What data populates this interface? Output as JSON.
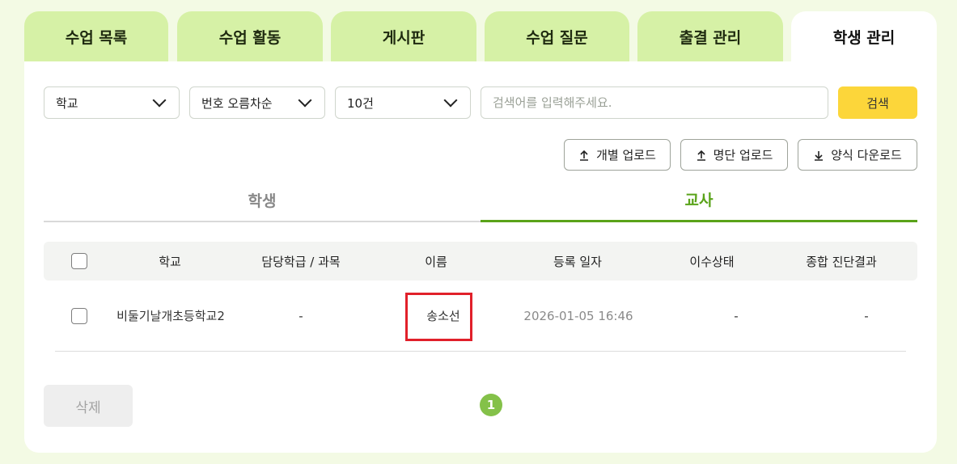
{
  "tabs": [
    {
      "label": "수업 목록"
    },
    {
      "label": "수업 활동"
    },
    {
      "label": "게시판"
    },
    {
      "label": "수업 질문"
    },
    {
      "label": "출결 관리"
    },
    {
      "label": "학생 관리",
      "active": true
    }
  ],
  "filters": {
    "school": "학교",
    "sort": "번호 오름차순",
    "page_size": "10건",
    "search_placeholder": "검색어를 입력해주세요.",
    "search_label": "검색"
  },
  "actions": {
    "individual_upload": "개별 업로드",
    "roster_upload": "명단 업로드",
    "template_download": "양식 다운로드"
  },
  "subtabs": [
    {
      "label": "학생"
    },
    {
      "label": "교사",
      "active": true
    }
  ],
  "table": {
    "headers": [
      "학교",
      "담당학급 / 과목",
      "이름",
      "등록 일자",
      "이수상태",
      "종합 진단결과"
    ],
    "rows": [
      {
        "school": "비둘기날개초등학교2",
        "class_subject": "-",
        "name": "송소선",
        "registered": "2026-01-05 16:46",
        "status": "-",
        "diagnosis": "-"
      }
    ]
  },
  "delete_label": "삭제",
  "pagination": {
    "current": "1"
  },
  "colors": {
    "accent_green": "#5aa31a",
    "tab_bg": "#d6f1a6",
    "search_yellow": "#fcd63a",
    "highlight_red": "#e1202a"
  }
}
